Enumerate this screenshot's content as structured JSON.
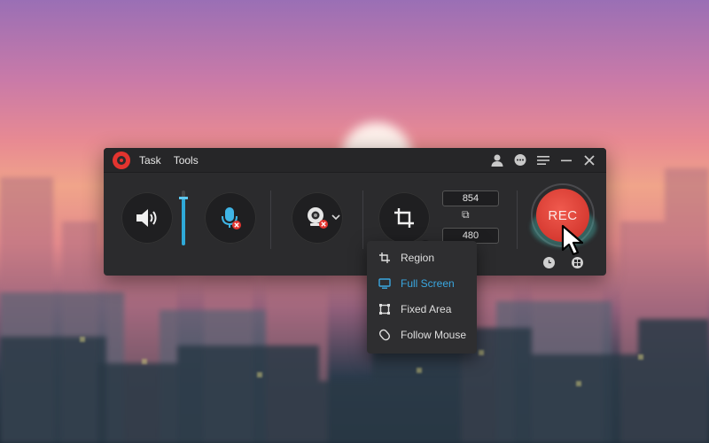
{
  "menu": {
    "task": "Task",
    "tools": "Tools"
  },
  "dimensions": {
    "width": "854",
    "height": "480"
  },
  "record": {
    "label": "REC"
  },
  "capture_menu": {
    "items": [
      {
        "label": "Region",
        "icon": "crop-icon",
        "active": false
      },
      {
        "label": "Full Screen",
        "icon": "monitor-icon",
        "active": true
      },
      {
        "label": "Fixed Area",
        "icon": "fixed-area-icon",
        "active": false
      },
      {
        "label": "Follow Mouse",
        "icon": "follow-mouse-icon",
        "active": false
      }
    ]
  },
  "volume": {
    "level": 0.85
  },
  "colors": {
    "accent": "#3aa7e0",
    "record": "#e3342f"
  }
}
